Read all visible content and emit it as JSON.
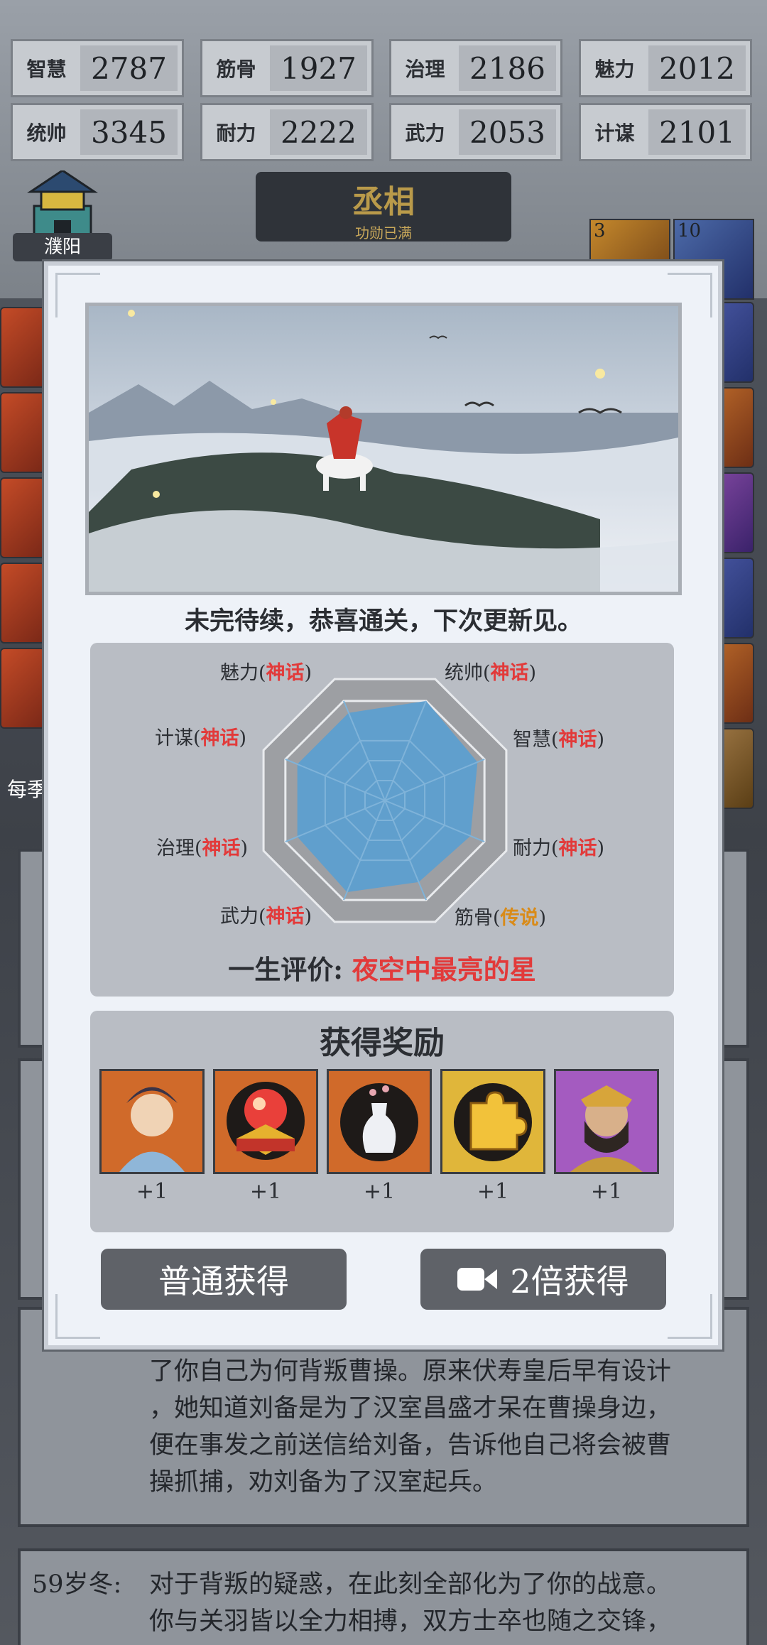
{
  "stats": [
    {
      "label": "智慧",
      "value": "2787"
    },
    {
      "label": "筋骨",
      "value": "1927"
    },
    {
      "label": "治理",
      "value": "2186"
    },
    {
      "label": "魅力",
      "value": "2012"
    },
    {
      "label": "统帅",
      "value": "3345"
    },
    {
      "label": "耐力",
      "value": "2222"
    },
    {
      "label": "武力",
      "value": "2053"
    },
    {
      "label": "计谋",
      "value": "2101"
    }
  ],
  "city": {
    "name": "濮阳"
  },
  "rank": {
    "title": "丞相",
    "subtitle": "功勋已满"
  },
  "right_badges": [
    "3",
    "10"
  ],
  "left_edge": {
    "label1": "每季"
  },
  "modal": {
    "caption": "未完待续，恭喜通关，下次更新见。",
    "radar": {
      "labels": [
        {
          "name": "魅力",
          "grade": "神话"
        },
        {
          "name": "统帅",
          "grade": "神话"
        },
        {
          "name": "计谋",
          "grade": "神话"
        },
        {
          "name": "智慧",
          "grade": "神话"
        },
        {
          "name": "治理",
          "grade": "神话"
        },
        {
          "name": "耐力",
          "grade": "神话"
        },
        {
          "name": "武力",
          "grade": "神话"
        },
        {
          "name": "筋骨",
          "grade": "传说"
        }
      ],
      "levels": [
        0.88,
        1.0,
        0.88,
        0.93,
        0.88,
        0.86,
        0.92,
        0.82
      ]
    },
    "evaluation_label": "一生评价:",
    "evaluation_value": "夜空中最亮的星",
    "reward_title": "获得奖励",
    "rewards": [
      {
        "icon": "hero-portrait-icon",
        "count": "+1"
      },
      {
        "icon": "crystal-orb-icon",
        "count": "+1"
      },
      {
        "icon": "vase-icon",
        "count": "+1"
      },
      {
        "icon": "puzzle-piece-icon",
        "count": "+1"
      },
      {
        "icon": "warrior-portrait-icon",
        "count": "+1"
      }
    ],
    "btn_normal": "普通获得",
    "btn_double": "2倍获得"
  },
  "log": {
    "text1": "了你自己为何背叛曹操。原来伏寿皇后早有设计",
    "text2": "，她知道刘备是为了汉室昌盛才呆在曹操身边，",
    "text3": "便在事发之前送信给刘备，告诉他自己将会被曹",
    "text4": "操抓捕，劝刘备为了汉室起兵。",
    "entry_date": "59岁冬:",
    "entry_text1": "对于背叛的疑惑，在此刻全部化为了你的战意。",
    "entry_text2": "你与关羽皆以全力相搏，双方士卒也随之交锋，"
  },
  "colors": {
    "myth": "#e23a3a",
    "legend": "#d98b19",
    "radar_fill": "#5a9fd1"
  }
}
